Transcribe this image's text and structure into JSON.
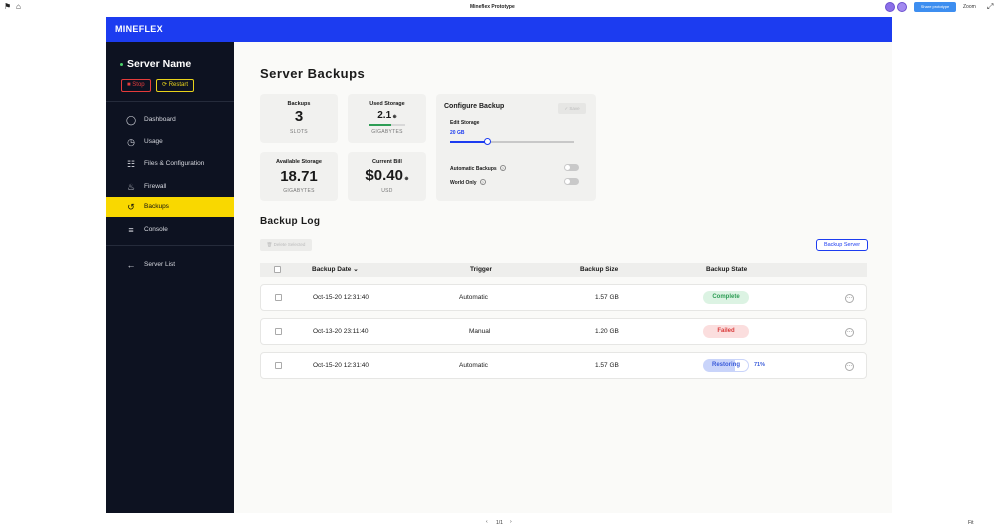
{
  "chrome": {
    "title": "Mineflex Prototype",
    "share_label": "Share prototype",
    "zoom_label": "Zoom",
    "page_counter": "1/1",
    "fit_label": "Fit"
  },
  "app": {
    "brand": "MINEFLEX",
    "server": {
      "name": "Server Name",
      "stop_label": "Stop",
      "restart_label": "Restart"
    },
    "nav": [
      {
        "label": "Dashboard",
        "icon": "power-icon"
      },
      {
        "label": "Usage",
        "icon": "clock-icon"
      },
      {
        "label": "Files & Configuration",
        "icon": "sliders-icon"
      },
      {
        "label": "Firewall",
        "icon": "flame-icon"
      },
      {
        "label": "Backups",
        "icon": "backup-icon",
        "active": true
      },
      {
        "label": "Console",
        "icon": "lines-icon"
      }
    ],
    "server_list_label": "Server List",
    "page_title": "Server Backups",
    "stats": {
      "backups": {
        "label": "Backups",
        "value": "3",
        "unit": "SLOTS"
      },
      "used_storage": {
        "label": "Used Storage",
        "value": "2.1",
        "unit": "GIGABYTES",
        "fill_fraction": 0.6
      },
      "available_storage": {
        "label": "Available Storage",
        "value": "18.71",
        "unit": "GIGABYTES"
      },
      "current_bill": {
        "label": "Current Bill",
        "value": "$0.40",
        "unit": "USD"
      }
    },
    "configure": {
      "title": "Configure Backup",
      "save_label": "Save",
      "edit_storage_label": "Edit Storage",
      "edit_storage_value": "20 GB",
      "slider_fraction": 0.3,
      "automatic_backups_label": "Automatic Backups",
      "automatic_backups_on": false,
      "world_only_label": "World Only",
      "world_only_on": false
    },
    "log": {
      "title": "Backup Log",
      "delete_label": "Delete Selected",
      "backup_server_label": "Backup Server",
      "columns": [
        "Backup Date",
        "Trigger",
        "Backup Size",
        "Backup State"
      ],
      "rows": [
        {
          "date": "Oct-15-20 12:31:40",
          "trigger": "Automatic",
          "size": "1.57 GB",
          "state": "Complete",
          "progress": ""
        },
        {
          "date": "Oct-13-20 23:11:40",
          "trigger": "Manual",
          "size": "1.20 GB",
          "state": "Failed",
          "progress": ""
        },
        {
          "date": "Oct-15-20 12:31:40",
          "trigger": "Automatic",
          "size": "1.57 GB",
          "state": "Restoring",
          "progress": "71%"
        }
      ]
    },
    "colors": {
      "brand_blue": "#1c3cf0",
      "sidebar_bg": "#0d1221",
      "active_yellow": "#f9d800",
      "complete": "#2e9d55",
      "failed": "#d93a3a",
      "restoring": "#3a5bd9"
    }
  }
}
